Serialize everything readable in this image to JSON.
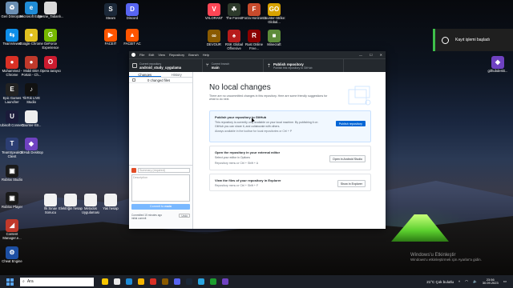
{
  "desktop_icons": [
    {
      "id": "recycle",
      "label": "Geri Dönüşüm",
      "color": "#6b8fb3",
      "glyph": "♻",
      "col": 0,
      "row": 0
    },
    {
      "id": "edge",
      "label": "Microsoft Edge",
      "color": "#1f8bd6",
      "glyph": "e",
      "col": 1,
      "row": 0
    },
    {
      "id": "nesne",
      "label": "Nesne_Tabanlı...",
      "color": "#d9d9d9",
      "glyph": "",
      "col": 2,
      "row": 0
    },
    {
      "id": "teamviewer",
      "label": "TeamViewer",
      "color": "#0e8ee9",
      "glyph": "⇆",
      "col": 0,
      "row": 1
    },
    {
      "id": "chrome",
      "label": "Google Chrome",
      "color": "#e0c020",
      "glyph": "●",
      "col": 1,
      "row": 1
    },
    {
      "id": "geforce",
      "label": "GeForce Experience",
      "color": "#76b900",
      "glyph": "G",
      "col": 2,
      "row": 1
    },
    {
      "id": "muhammed-chrome",
      "label": "Muhammed - Chrome",
      "color": "#d93025",
      "glyph": "●",
      "col": 0,
      "row": 2
    },
    {
      "id": "meb",
      "label": "Mobil EBA Portalı - Ch...",
      "color": "#c0392b",
      "glyph": "●",
      "col": 1,
      "row": 2
    },
    {
      "id": "opera",
      "label": "Opera tarayıcı",
      "color": "#cc1b2f",
      "glyph": "O",
      "col": 2,
      "row": 2
    },
    {
      "id": "epic",
      "label": "Epic Games Launcher",
      "color": "#222222",
      "glyph": "E",
      "col": 0,
      "row": 3
    },
    {
      "id": "tiktok",
      "label": "TikTok LIVE Studio",
      "color": "#111111",
      "glyph": "♪",
      "col": 1,
      "row": 3
    },
    {
      "id": "ubisoft",
      "label": "Ubisoft Connect",
      "color": "#1b1b3a",
      "glyph": "U",
      "col": 0,
      "row": 4
    },
    {
      "id": "counter",
      "label": "Counter-Str...",
      "color": "#eeeeee",
      "glyph": "",
      "col": 1,
      "row": 4
    },
    {
      "id": "teamspeak",
      "label": "TeamSpeak 3 Client",
      "color": "#2c3e73",
      "glyph": "T",
      "col": 0,
      "row": 5
    },
    {
      "id": "githubdesktop",
      "label": "GitHub Desktop",
      "color": "#6f42c1",
      "glyph": "◆",
      "col": 1,
      "row": 5
    },
    {
      "id": "roblox-studio",
      "label": "Roblox Studio",
      "color": "#1a1a1a",
      "glyph": "▣",
      "col": 0,
      "row": 6
    },
    {
      "id": "roblox-player",
      "label": "Roblox Player",
      "color": "#1a1a1a",
      "glyph": "▣",
      "col": 0,
      "row": 7
    },
    {
      "id": "content",
      "label": "Content Manager.e...",
      "color": "#c0392b",
      "glyph": "◢",
      "col": 0,
      "row": 8
    },
    {
      "id": "cheat",
      "label": "Cheat Engine",
      "color": "#1d4fa3",
      "glyph": "⚙",
      "col": 0,
      "row": 9
    }
  ],
  "desktop_icons_center": [
    {
      "id": "steam",
      "label": "Steam",
      "color": "#1b2838",
      "glyph": "S"
    },
    {
      "id": "discord",
      "label": "Discord",
      "color": "#5865f2",
      "glyph": "D"
    },
    {
      "id": "faceit",
      "label": "FACEIT",
      "color": "#ff5500",
      "glyph": "▶"
    },
    {
      "id": "faceitac",
      "label": "FACEIT AC",
      "color": "#ff5500",
      "glyph": "▲"
    }
  ],
  "desktop_icons_games": [
    {
      "id": "valorant",
      "label": "VALORANT",
      "color": "#ff4655",
      "glyph": "V"
    },
    {
      "id": "forest",
      "label": "The Forest",
      "color": "#2d3a2b",
      "glyph": "☘"
    },
    {
      "id": "forza",
      "label": "Forza Horizon 4",
      "color": "#c84b2c",
      "glyph": "F"
    },
    {
      "id": "csgo",
      "label": "Counter-Strike: Global...",
      "color": "#d8a200",
      "glyph": "GO"
    },
    {
      "id": "devour",
      "label": "DEVOUR",
      "color": "#8a5a00",
      "glyph": "∞"
    },
    {
      "id": "rsk",
      "label": "RSK Global Offensive",
      "color": "#b71c1c",
      "glyph": "♠"
    },
    {
      "id": "rust",
      "label": "Rust Online Free...",
      "color": "#8b0000",
      "glyph": "R"
    },
    {
      "id": "minecraft",
      "label": "Minecraft",
      "color": "#5d8c3a",
      "glyph": "■"
    }
  ],
  "desktop_icons_bottom": [
    {
      "id": "ilk-sinav",
      "label": "İlk Sınav Sonucu"
    },
    {
      "id": "elektrik",
      "label": "Elektriğin hesap"
    },
    {
      "id": "metodos",
      "label": "Metodos Uygulaması"
    },
    {
      "id": "yas",
      "label": "Yas hesap"
    }
  ],
  "desktop_icon_right": {
    "label": "githubdeskt...",
    "color": "#6f42c1",
    "glyph": "◆"
  },
  "toast": {
    "text": "Kayıt işlemi başladı"
  },
  "window": {
    "menu": [
      "File",
      "Edit",
      "View",
      "Repository",
      "Branch",
      "Help"
    ],
    "toolbar": {
      "repo_label": "Current repository",
      "repo_name": "android_study_uygulama",
      "branch_label": "Current branch",
      "branch_name": "main",
      "publish_label": "Publish repository",
      "publish_sub": "Publish this repository to GitHub"
    },
    "sidebar": {
      "tabs": [
        "Changes",
        "History"
      ],
      "changed_files": "0 changed files",
      "summary_placeholder": "Summary (required)",
      "description_placeholder": "Description",
      "commit_button_prefix": "Commit to ",
      "commit_button_branch": "main",
      "committed_info": "Committed 15 minutes ago",
      "commit_name": "initial commit",
      "undo_label": "Undo"
    },
    "main": {
      "title": "No local changes",
      "subtitle": "There are no uncommitted changes in this repository. Here are some friendly suggestions for what to do next.",
      "cards": [
        {
          "title": "Publish your repository to GitHub",
          "desc": "This repository is currently only available on your local machine. By publishing it on GitHub you can share it, and collaborate with others.",
          "hint": "Always available in the toolbar for local repositories or Ctrl + P",
          "button": "Publish repository"
        },
        {
          "title": "Open the repository in your external editor",
          "desc": "Select your editor in Options",
          "hint": "Repository menu or Ctrl + Shift + A",
          "button": "Open in Android Studio"
        },
        {
          "title": "View the files of your repository in Explorer",
          "desc": "",
          "hint": "Repository menu or Ctrl + Shift + F",
          "button": "Show in Explorer"
        }
      ]
    }
  },
  "watermark": {
    "line1": "Windows'u Etkinleştir",
    "line2": "Windows'u etkinleştirmek için Ayarlar'a gidin."
  },
  "taskbar": {
    "search_placeholder": "Ara",
    "apps": [
      "#f7c600",
      "#e8e8e8",
      "#1f8bd6",
      "#f5b400",
      "#d93025",
      "#8a5a00",
      "#5865f2",
      "#1b2838",
      "#2aa5e0",
      "#1c9e2e",
      "#6f42c1"
    ],
    "weather": "21°C  Çok bulutlu",
    "time": "23:56",
    "date": "30.09.2023"
  }
}
